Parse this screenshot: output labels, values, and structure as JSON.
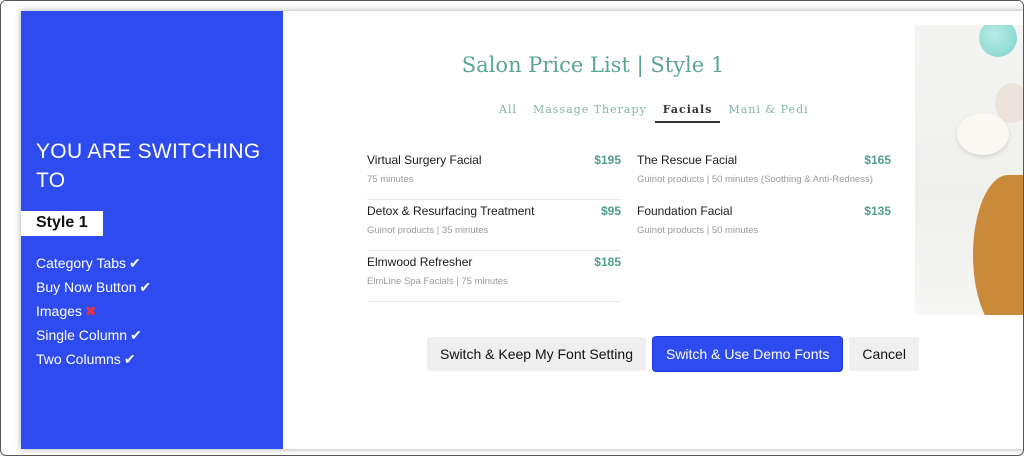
{
  "side": {
    "heading": "YOU ARE SWITCHING TO",
    "style_label": "Style 1",
    "features": [
      {
        "label": "Category Tabs",
        "mark": "✔",
        "enabled": true
      },
      {
        "label": "Buy Now Button",
        "mark": "✔",
        "enabled": true
      },
      {
        "label": "Images",
        "mark": "✖",
        "enabled": false
      },
      {
        "label": "Single Column",
        "mark": "✔",
        "enabled": true
      },
      {
        "label": "Two Columns",
        "mark": "✔",
        "enabled": true
      }
    ],
    "accent_color": "#2e4bf0"
  },
  "preview": {
    "title": "Salon Price List | Style 1",
    "tabs": [
      {
        "label": "All",
        "active": false
      },
      {
        "label": "Massage Therapy",
        "active": false
      },
      {
        "label": "Facials",
        "active": true
      },
      {
        "label": "Mani & Pedi",
        "active": false
      }
    ],
    "left_items": [
      {
        "name": "Virtual Surgery Facial",
        "price": "$195",
        "desc": "75 minutes"
      },
      {
        "name": "Detox & Resurfacing Treatment",
        "price": "$95",
        "desc": "Guinot products | 35 minutes"
      },
      {
        "name": "Elmwood Refresher",
        "price": "$185",
        "desc": "ElmLine Spa Facials | 75 minutes"
      }
    ],
    "right_items": [
      {
        "name": "The Rescue Facial",
        "price": "$165",
        "desc": "Guinot products | 50 minutes (Soothing & Anti-Redness)"
      },
      {
        "name": "Foundation Facial",
        "price": "$135",
        "desc": "Guinot products | 50 minutes"
      }
    ],
    "price_color": "#4fa08f"
  },
  "buttons": {
    "keep_font": "Switch & Keep My Font Setting",
    "demo_fonts": "Switch & Use Demo Fonts",
    "cancel": "Cancel"
  }
}
